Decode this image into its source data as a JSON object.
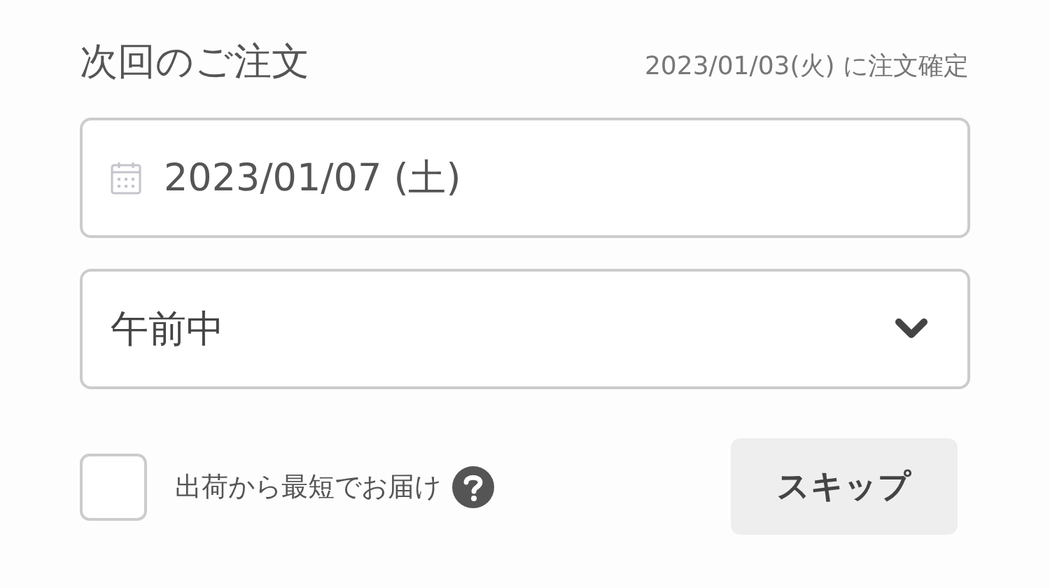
{
  "header": {
    "title": "次回のご注文",
    "confirm_note": "2023/01/03(火) に注文確定"
  },
  "date_field": {
    "value": "2023/01/07 (土)"
  },
  "time_select": {
    "value": "午前中"
  },
  "fastest": {
    "label": "出荷から最短でお届け",
    "checked": false
  },
  "skip_button": {
    "label": "スキップ"
  }
}
